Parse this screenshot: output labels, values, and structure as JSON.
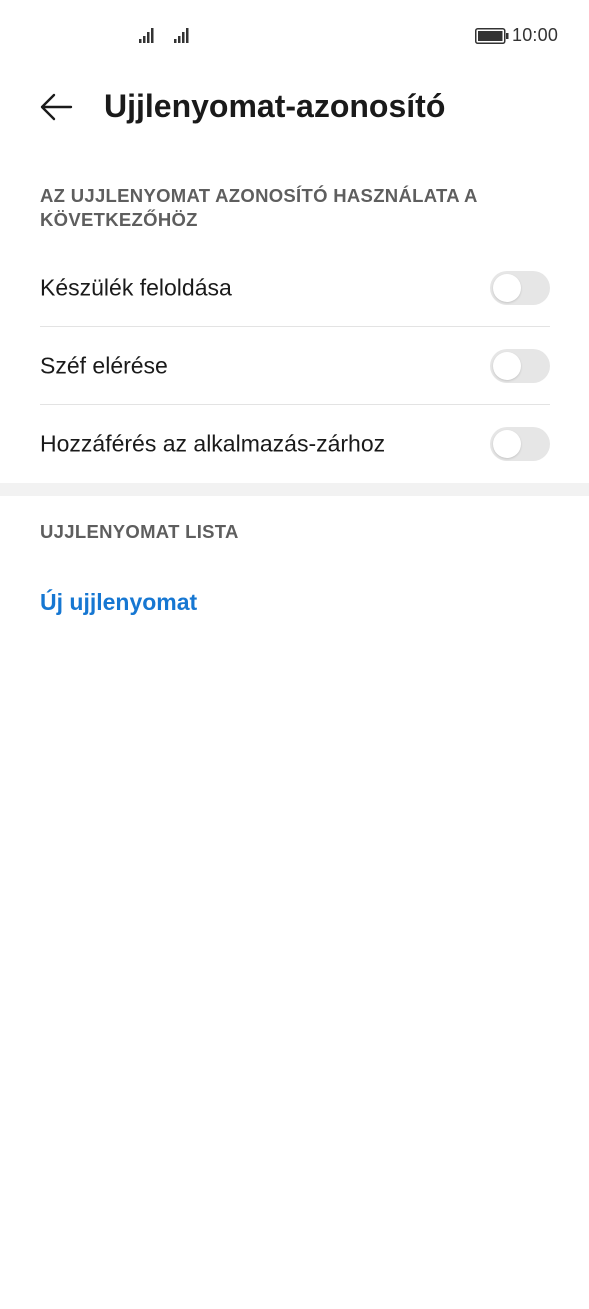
{
  "status_bar": {
    "time": "10:00",
    "signal_icon_1": "signal-strength-icon",
    "signal_icon_2": "signal-strength-icon",
    "battery_icon": "battery-icon"
  },
  "header": {
    "back_icon": "arrow-left-icon",
    "title": "Ujjlenyomat-azonosító"
  },
  "usage_section": {
    "header": "AZ UJJLENYOMAT AZONOSÍTÓ HASZNÁLATA A KÖVETKEZŐHÖZ",
    "items": [
      {
        "label": "Készülék feloldása",
        "enabled": false
      },
      {
        "label": "Széf elérése",
        "enabled": false
      },
      {
        "label": "Hozzáférés az alkalmazás-zárhoz",
        "enabled": false
      }
    ]
  },
  "list_section": {
    "header": "UJJLENYOMAT LISTA",
    "add_link": "Új ujjlenyomat"
  },
  "colors": {
    "accent": "#1677d2",
    "toggle_off": "#e6e6e6",
    "section_header": "#5e5e5e",
    "section_gap": "#f2f2f2"
  }
}
